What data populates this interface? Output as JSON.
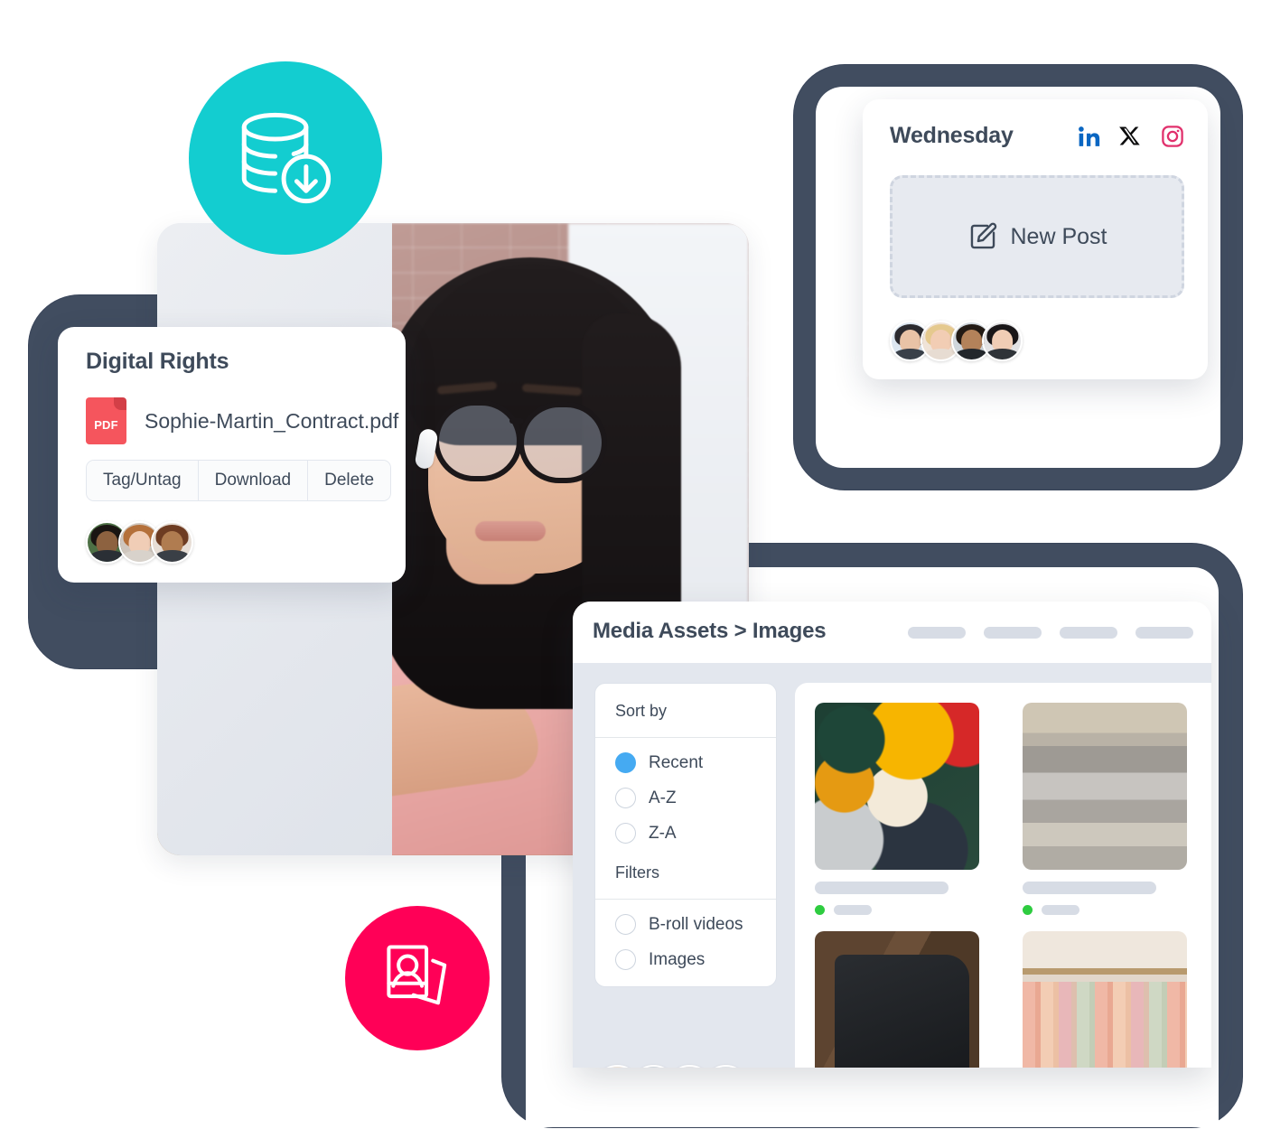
{
  "digital_rights": {
    "title": "Digital Rights",
    "file": {
      "name": "Sophie-Martin_Contract.pdf",
      "type_label": "PDF"
    },
    "buttons": [
      "Tag/Untag",
      "Download",
      "Delete"
    ],
    "collaborator_count": 3
  },
  "scheduler": {
    "day_title": "Wednesday",
    "socials": [
      "linkedin-icon",
      "x-icon",
      "instagram-icon"
    ],
    "new_post_label": "New Post",
    "new_post_icon": "edit-square-icon",
    "collaborator_count": 4
  },
  "media_assets": {
    "breadcrumb": "Media Assets > Images",
    "toolbar_placeholder_count": 4,
    "sidebar": {
      "sort_title": "Sort by",
      "sort_options": [
        {
          "label": "Recent",
          "selected": true
        },
        {
          "label": "A-Z",
          "selected": false
        },
        {
          "label": "Z-A",
          "selected": false
        }
      ],
      "filters_title": "Filters",
      "filter_options": [
        {
          "label": "B-roll videos",
          "selected": false
        },
        {
          "label": "Images",
          "selected": false
        }
      ]
    },
    "collaborator_count": 4,
    "thumbnails": [
      {
        "art": "t1",
        "alt": "colorful-hoodies-pile",
        "status": "green"
      },
      {
        "art": "t2",
        "alt": "folded-grey-sweatshirts",
        "status": "green"
      },
      {
        "art": "t3",
        "alt": "black-sweatpants-on-wood",
        "status": "green"
      },
      {
        "art": "t4",
        "alt": "pink-knit-sweaters-on-hangers",
        "status": "green"
      }
    ]
  },
  "badges": {
    "database_download": {
      "icon": "database-download-icon",
      "color": "#13CDD0"
    },
    "portrait_photos": {
      "icon": "portrait-photos-icon",
      "color": "#FF0057"
    }
  },
  "hero_photo": {
    "alt": "woman-with-glasses-at-desk"
  },
  "colors": {
    "frame": "#414D60",
    "accent_blue": "#45AAF2",
    "pdf_red": "#F5555D",
    "status_green": "#2ECC40",
    "linkedin": "#0A66C2",
    "instagram": "#E1306C",
    "text": "#3E4A5A"
  }
}
